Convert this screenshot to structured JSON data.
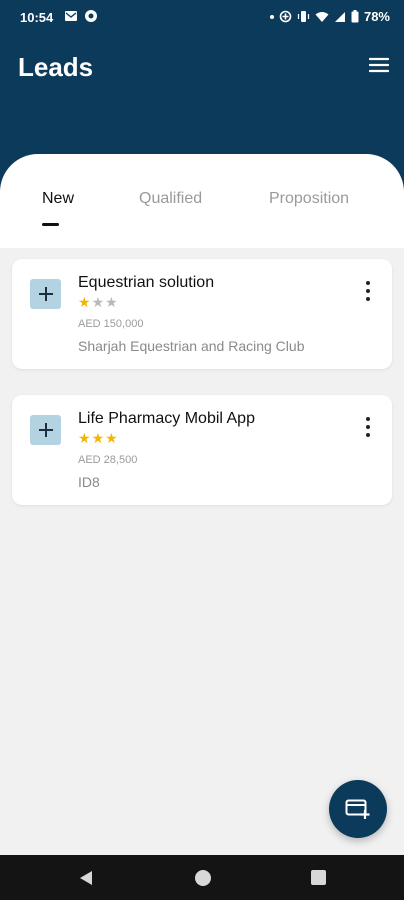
{
  "status": {
    "time": "10:54",
    "battery": "78%"
  },
  "header": {
    "title": "Leads"
  },
  "tabs": [
    {
      "label": "New",
      "active": true
    },
    {
      "label": "Qualified",
      "active": false
    },
    {
      "label": "Proposition",
      "active": false
    }
  ],
  "leads": [
    {
      "title": "Equestrian solution",
      "rating": 1,
      "rating_max": 3,
      "amount": "AED  150,000",
      "company": "Sharjah Equestrian and Racing Club",
      "icon": "plus-icon"
    },
    {
      "title": "Life Pharmacy Mobil App",
      "rating": 3,
      "rating_max": 3,
      "amount": "AED  28,500",
      "company": "ID8",
      "icon": "plus-icon"
    }
  ],
  "fab": {
    "icon": "add-card-icon"
  },
  "colors": {
    "primary": "#0c3a5a",
    "star_active": "#f2b705",
    "icon_bg": "#b3d3e3"
  }
}
